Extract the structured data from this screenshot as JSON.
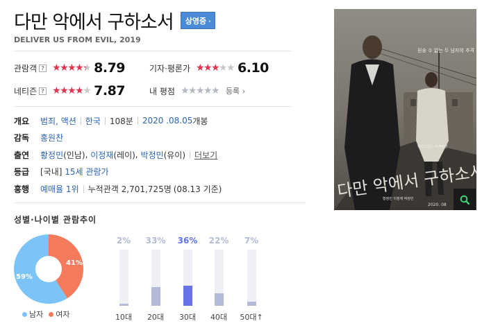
{
  "movie": {
    "title": "다만 악에서 구하소서",
    "status_label": "상영중",
    "status_arrow": "›",
    "subtitle": "DELIVER US FROM EVIL, 2019"
  },
  "ratings": {
    "audience": {
      "label": "관람객",
      "help": "?",
      "score": "8.79",
      "stars": 4.4
    },
    "critics": {
      "label": "기자·평론가",
      "score": "6.10",
      "stars": 3.05
    },
    "netizen": {
      "label": "네티즌",
      "help": "?",
      "score": "7.87",
      "stars": 3.95
    },
    "mine": {
      "label": "내 평점",
      "register_label": "등록",
      "register_arrow": "›"
    }
  },
  "info": {
    "overview_label": "개요",
    "genre": "범죄, 액션",
    "country": "한국",
    "runtime": "108분",
    "release_date": "2020 .08.05",
    "release_suffix": " 개봉",
    "director_label": "감독",
    "director": "홍원찬",
    "cast_label": "출연",
    "cast_1": "황정민",
    "cast_1_role": "(인남)",
    "cast_2": "이정재",
    "cast_2_role": "(레이)",
    "cast_3": "박정민",
    "cast_3_role": "(유이)",
    "cast_sep": ", ",
    "more_label": "더보기",
    "grade_label": "등급",
    "grade_region": "[국내]",
    "grade": "15세 관람가",
    "box_label": "흥행",
    "box_rank": "예매율 1위",
    "audience_prefix": "누적관객",
    "audience_count": "2,701,725명",
    "audience_date": "(08.13 기준)"
  },
  "poster": {
    "tagline": "원숭 수 없는 두 남자의 추격",
    "title_text": "다만 악에서 구하소서",
    "small_names": "황정민   이정재   박정민",
    "date_text": "2020. 08",
    "corner_text": "하드보일드 추격액션"
  },
  "stats": {
    "title": "성별·나이별 관람추이",
    "gender": {
      "male_label": "남자",
      "female_label": "여자",
      "male_pct": "59%",
      "female_pct": "41%",
      "male_value": 59,
      "female_value": 41,
      "male_color": "#7cc4f7",
      "female_color": "#f47a5c"
    },
    "age": [
      {
        "label": "10대",
        "pct": "2%",
        "value": 2
      },
      {
        "label": "20대",
        "pct": "33%",
        "value": 33
      },
      {
        "label": "30대",
        "pct": "36%",
        "value": 36,
        "peak": true
      },
      {
        "label": "40대",
        "pct": "22%",
        "value": 22
      },
      {
        "label": "50대↑",
        "pct": "7%",
        "value": 7
      }
    ]
  },
  "colors": {
    "star_on": "#e0334d",
    "star_off": "#c7c7c7",
    "link": "#2b63b8",
    "status_button": "#4b8ad6",
    "age_peak": "#6874e6",
    "age_bar": "#b3bbd8"
  },
  "icons": {
    "help": "help-icon",
    "zoom": "search-icon"
  }
}
